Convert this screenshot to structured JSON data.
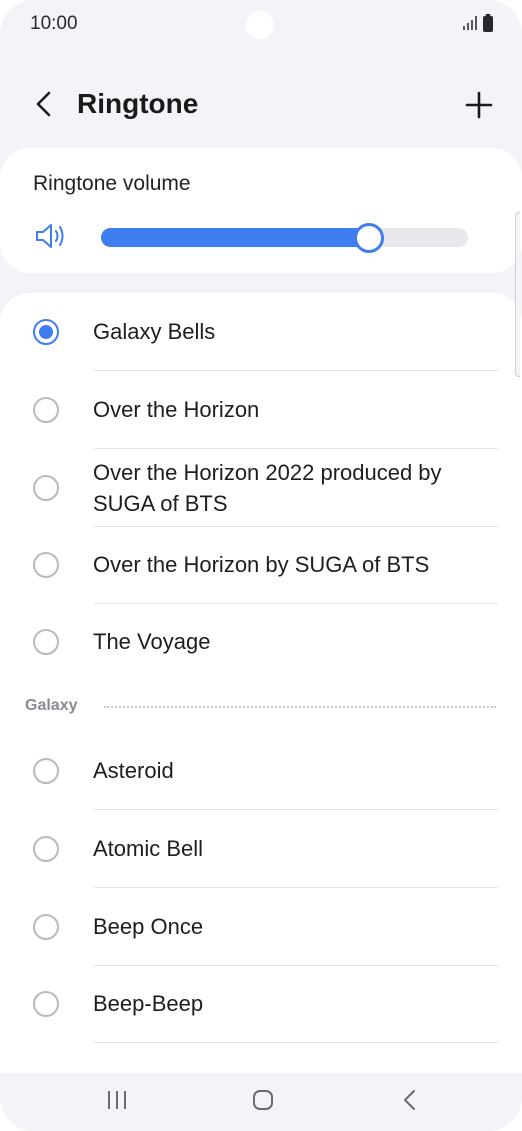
{
  "status_bar": {
    "time": "10:00"
  },
  "header": {
    "title": "Ringtone"
  },
  "volume": {
    "label": "Ringtone volume",
    "level": 0.73
  },
  "ringtones": [
    {
      "label": "Galaxy Bells",
      "selected": true
    },
    {
      "label": "Over the Horizon",
      "selected": false
    },
    {
      "label": "Over the Horizon 2022 produced by SUGA of BTS",
      "selected": false
    },
    {
      "label": "Over the Horizon by SUGA of BTS",
      "selected": false
    },
    {
      "label": "The Voyage",
      "selected": false
    }
  ],
  "section": {
    "label": "Galaxy"
  },
  "galaxy_ringtones": [
    {
      "label": "Asteroid",
      "selected": false
    },
    {
      "label": "Atomic Bell",
      "selected": false
    },
    {
      "label": "Beep Once",
      "selected": false
    },
    {
      "label": "Beep-Beep",
      "selected": false
    }
  ],
  "colors": {
    "accent": "#3e7ef0",
    "background": "#f4f4f8",
    "card": "#ffffff"
  },
  "icons": {
    "back": "chevron-left-icon",
    "add": "plus-icon",
    "volume": "speaker-icon",
    "signal": "signal-icon",
    "battery": "battery-icon"
  }
}
